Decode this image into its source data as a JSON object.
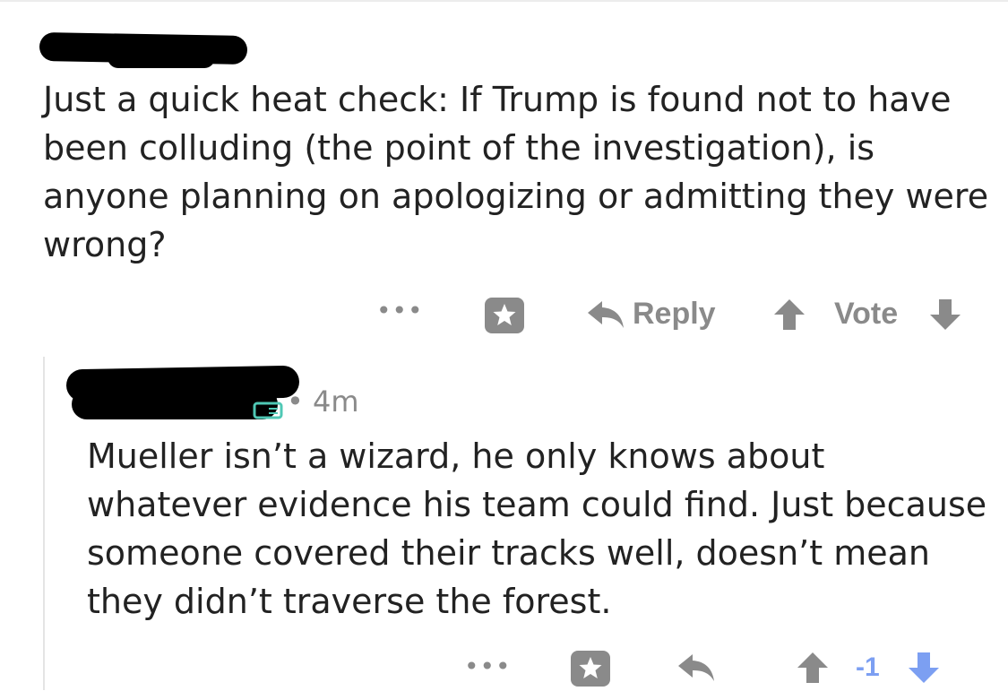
{
  "post": {
    "author_redacted": "",
    "body": "Just a quick heat check: If Trump is found not to have been colluding (the point of the investigation), is anyone planning on apologizing or admitting they were wrong?",
    "actions": {
      "more_label": "•••",
      "reply_label": "Reply",
      "vote_label": "Vote"
    }
  },
  "reply": {
    "meta": "• 4m",
    "body": "Mueller isn’t a wizard, he only knows about whatever evidence his team could find. Just because someone covered their tracks well, doesn’t mean they didn’t traverse the forest.",
    "actions": {
      "more_label": "•••",
      "score": "-1"
    }
  },
  "colors": {
    "icon_gray": "#8a8a8a",
    "downvote_blue": "#7c9ff2",
    "mod_badge": "#4fc8b5"
  },
  "icons": [
    "more-icon",
    "award-icon",
    "reply-icon",
    "upvote-icon",
    "downvote-icon"
  ]
}
